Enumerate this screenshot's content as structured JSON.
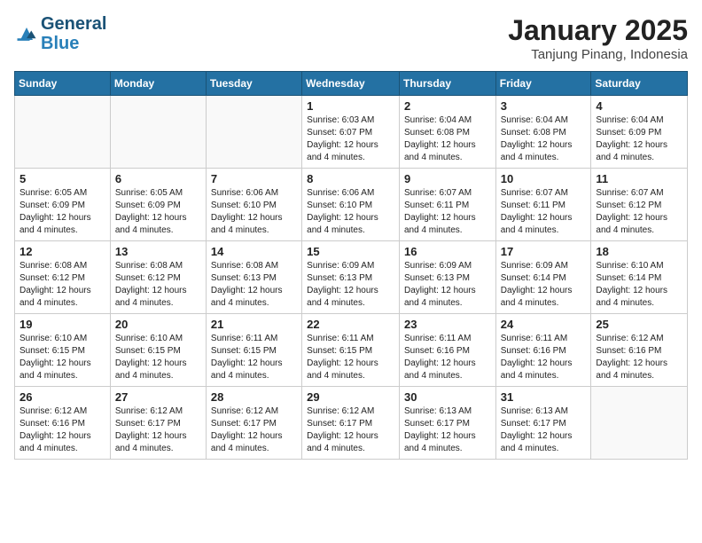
{
  "header": {
    "logo_line1": "General",
    "logo_line2": "Blue",
    "month": "January 2025",
    "location": "Tanjung Pinang, Indonesia"
  },
  "weekdays": [
    "Sunday",
    "Monday",
    "Tuesday",
    "Wednesday",
    "Thursday",
    "Friday",
    "Saturday"
  ],
  "weeks": [
    [
      {
        "day": "",
        "empty": true
      },
      {
        "day": "",
        "empty": true
      },
      {
        "day": "",
        "empty": true
      },
      {
        "day": "1",
        "sunrise": "6:03 AM",
        "sunset": "6:07 PM",
        "daylight": "12 hours and 4 minutes."
      },
      {
        "day": "2",
        "sunrise": "6:04 AM",
        "sunset": "6:08 PM",
        "daylight": "12 hours and 4 minutes."
      },
      {
        "day": "3",
        "sunrise": "6:04 AM",
        "sunset": "6:08 PM",
        "daylight": "12 hours and 4 minutes."
      },
      {
        "day": "4",
        "sunrise": "6:04 AM",
        "sunset": "6:09 PM",
        "daylight": "12 hours and 4 minutes."
      }
    ],
    [
      {
        "day": "5",
        "sunrise": "6:05 AM",
        "sunset": "6:09 PM",
        "daylight": "12 hours and 4 minutes."
      },
      {
        "day": "6",
        "sunrise": "6:05 AM",
        "sunset": "6:09 PM",
        "daylight": "12 hours and 4 minutes."
      },
      {
        "day": "7",
        "sunrise": "6:06 AM",
        "sunset": "6:10 PM",
        "daylight": "12 hours and 4 minutes."
      },
      {
        "day": "8",
        "sunrise": "6:06 AM",
        "sunset": "6:10 PM",
        "daylight": "12 hours and 4 minutes."
      },
      {
        "day": "9",
        "sunrise": "6:07 AM",
        "sunset": "6:11 PM",
        "daylight": "12 hours and 4 minutes."
      },
      {
        "day": "10",
        "sunrise": "6:07 AM",
        "sunset": "6:11 PM",
        "daylight": "12 hours and 4 minutes."
      },
      {
        "day": "11",
        "sunrise": "6:07 AM",
        "sunset": "6:12 PM",
        "daylight": "12 hours and 4 minutes."
      }
    ],
    [
      {
        "day": "12",
        "sunrise": "6:08 AM",
        "sunset": "6:12 PM",
        "daylight": "12 hours and 4 minutes."
      },
      {
        "day": "13",
        "sunrise": "6:08 AM",
        "sunset": "6:12 PM",
        "daylight": "12 hours and 4 minutes."
      },
      {
        "day": "14",
        "sunrise": "6:08 AM",
        "sunset": "6:13 PM",
        "daylight": "12 hours and 4 minutes."
      },
      {
        "day": "15",
        "sunrise": "6:09 AM",
        "sunset": "6:13 PM",
        "daylight": "12 hours and 4 minutes."
      },
      {
        "day": "16",
        "sunrise": "6:09 AM",
        "sunset": "6:13 PM",
        "daylight": "12 hours and 4 minutes."
      },
      {
        "day": "17",
        "sunrise": "6:09 AM",
        "sunset": "6:14 PM",
        "daylight": "12 hours and 4 minutes."
      },
      {
        "day": "18",
        "sunrise": "6:10 AM",
        "sunset": "6:14 PM",
        "daylight": "12 hours and 4 minutes."
      }
    ],
    [
      {
        "day": "19",
        "sunrise": "6:10 AM",
        "sunset": "6:15 PM",
        "daylight": "12 hours and 4 minutes."
      },
      {
        "day": "20",
        "sunrise": "6:10 AM",
        "sunset": "6:15 PM",
        "daylight": "12 hours and 4 minutes."
      },
      {
        "day": "21",
        "sunrise": "6:11 AM",
        "sunset": "6:15 PM",
        "daylight": "12 hours and 4 minutes."
      },
      {
        "day": "22",
        "sunrise": "6:11 AM",
        "sunset": "6:15 PM",
        "daylight": "12 hours and 4 minutes."
      },
      {
        "day": "23",
        "sunrise": "6:11 AM",
        "sunset": "6:16 PM",
        "daylight": "12 hours and 4 minutes."
      },
      {
        "day": "24",
        "sunrise": "6:11 AM",
        "sunset": "6:16 PM",
        "daylight": "12 hours and 4 minutes."
      },
      {
        "day": "25",
        "sunrise": "6:12 AM",
        "sunset": "6:16 PM",
        "daylight": "12 hours and 4 minutes."
      }
    ],
    [
      {
        "day": "26",
        "sunrise": "6:12 AM",
        "sunset": "6:16 PM",
        "daylight": "12 hours and 4 minutes."
      },
      {
        "day": "27",
        "sunrise": "6:12 AM",
        "sunset": "6:17 PM",
        "daylight": "12 hours and 4 minutes."
      },
      {
        "day": "28",
        "sunrise": "6:12 AM",
        "sunset": "6:17 PM",
        "daylight": "12 hours and 4 minutes."
      },
      {
        "day": "29",
        "sunrise": "6:12 AM",
        "sunset": "6:17 PM",
        "daylight": "12 hours and 4 minutes."
      },
      {
        "day": "30",
        "sunrise": "6:13 AM",
        "sunset": "6:17 PM",
        "daylight": "12 hours and 4 minutes."
      },
      {
        "day": "31",
        "sunrise": "6:13 AM",
        "sunset": "6:17 PM",
        "daylight": "12 hours and 4 minutes."
      },
      {
        "day": "",
        "empty": true
      }
    ]
  ],
  "labels": {
    "sunrise": "Sunrise:",
    "sunset": "Sunset:",
    "daylight": "Daylight:"
  }
}
